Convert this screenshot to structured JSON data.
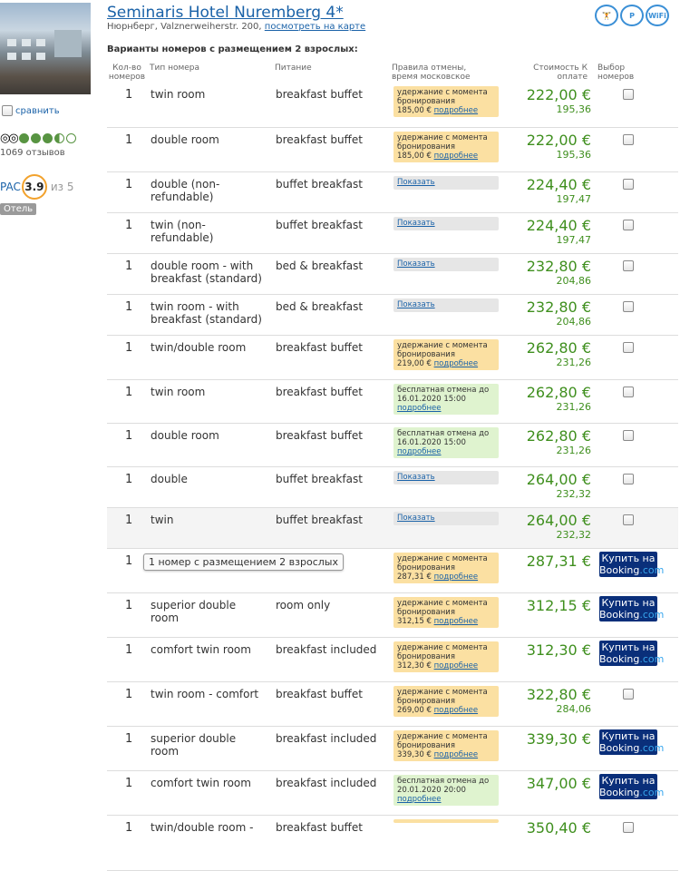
{
  "hotel": {
    "name": "Seminaris Hotel Nuremberg 4*",
    "address": "Нюрнберг, Valznerweiherstr. 200,",
    "map_link": "посмотреть на карте",
    "compare_label": "сравнить",
    "reviews": "1069 отзывов",
    "rating_prefix": "PAC",
    "rating": "3.9",
    "rating_of": "из 5",
    "tag": "Отель"
  },
  "amenities": [
    "fitness-icon",
    "parking-icon",
    "wifi-icon"
  ],
  "amenity_labels": [
    "🏋",
    "P",
    "WiFi"
  ],
  "section_title": "Варианты номеров с размещением 2 взрослых:",
  "columns": {
    "qty": "Кол-во номеров",
    "type": "Тип номера",
    "meal": "Питание",
    "cancel": "Правила отмены, время московское",
    "price": "Стоимость К оплате",
    "select": "Выбор номеров"
  },
  "rows": [
    {
      "qty": "1",
      "type": "twin room",
      "meal": "breakfast buffet",
      "cancel_kind": "orange",
      "cancel_text": "удержание с момента бронирования",
      "cancel_amount": "185,00 €",
      "cancel_link": "подробнее",
      "price": "222,00 €",
      "sub": "195,36",
      "action": "checkbox"
    },
    {
      "qty": "1",
      "type": "double room",
      "meal": "breakfast buffet",
      "cancel_kind": "orange",
      "cancel_text": "удержание с момента бронирования",
      "cancel_amount": "185,00 €",
      "cancel_link": "подробнее",
      "price": "222,00 €",
      "sub": "195,36",
      "action": "checkbox"
    },
    {
      "qty": "1",
      "type": "double (non-refundable)",
      "meal": "buffet breakfast",
      "cancel_kind": "gray",
      "cancel_text": "",
      "cancel_amount": "",
      "cancel_link": "Показать",
      "price": "224,40 €",
      "sub": "197,47",
      "action": "checkbox"
    },
    {
      "qty": "1",
      "type": "twin (non-refundable)",
      "meal": "buffet breakfast",
      "cancel_kind": "gray",
      "cancel_text": "",
      "cancel_amount": "",
      "cancel_link": "Показать",
      "price": "224,40 €",
      "sub": "197,47",
      "action": "checkbox"
    },
    {
      "qty": "1",
      "type": "double room - with breakfast (standard)",
      "meal": "bed & breakfast",
      "cancel_kind": "gray",
      "cancel_text": "",
      "cancel_amount": "",
      "cancel_link": "Показать",
      "price": "232,80 €",
      "sub": "204,86",
      "action": "checkbox"
    },
    {
      "qty": "1",
      "type": "twin room - with breakfast (standard)",
      "meal": "bed & breakfast",
      "cancel_kind": "gray",
      "cancel_text": "",
      "cancel_amount": "",
      "cancel_link": "Показать",
      "price": "232,80 €",
      "sub": "204,86",
      "action": "checkbox"
    },
    {
      "qty": "1",
      "type": "twin/double room",
      "meal": "breakfast buffet",
      "cancel_kind": "orange",
      "cancel_text": "удержание с момента бронирования",
      "cancel_amount": "219,00 €",
      "cancel_link": "подробнее",
      "price": "262,80 €",
      "sub": "231,26",
      "action": "checkbox"
    },
    {
      "qty": "1",
      "type": "twin room",
      "meal": "breakfast buffet",
      "cancel_kind": "green",
      "cancel_text": "бесплатная отмена до 16.01.2020 15:00",
      "cancel_amount": "",
      "cancel_link": "подробнее",
      "price": "262,80 €",
      "sub": "231,26",
      "action": "checkbox"
    },
    {
      "qty": "1",
      "type": "double room",
      "meal": "breakfast buffet",
      "cancel_kind": "green",
      "cancel_text": "бесплатная отмена до 16.01.2020 15:00",
      "cancel_amount": "",
      "cancel_link": "подробнее",
      "price": "262,80 €",
      "sub": "231,26",
      "action": "checkbox"
    },
    {
      "qty": "1",
      "type": "double",
      "meal": "buffet breakfast",
      "cancel_kind": "gray",
      "cancel_text": "",
      "cancel_amount": "",
      "cancel_link": "Показать",
      "price": "264,00 €",
      "sub": "232,32",
      "action": "checkbox"
    },
    {
      "qty": "1",
      "type": "twin",
      "meal": "buffet breakfast",
      "cancel_kind": "gray",
      "cancel_text": "",
      "cancel_amount": "",
      "cancel_link": "Показать",
      "price": "264,00 €",
      "sub": "232,32",
      "action": "checkbox"
    },
    {
      "qty": "1",
      "type": "",
      "meal": "",
      "tooltip": "1 номер с размещением 2 взрослых",
      "cancel_kind": "orange",
      "cancel_text": "удержание с момента бронирования",
      "cancel_amount": "287,31 €",
      "cancel_link": "подробнее",
      "price": "287,31 €",
      "sub": "",
      "action": "booking"
    },
    {
      "qty": "1",
      "type": "superior double room",
      "meal": "room only",
      "cancel_kind": "orange",
      "cancel_text": "удержание с момента бронирования",
      "cancel_amount": "312,15 €",
      "cancel_link": "подробнее",
      "price": "312,15 €",
      "sub": "",
      "action": "booking"
    },
    {
      "qty": "1",
      "type": "comfort twin room",
      "meal": "breakfast included",
      "cancel_kind": "orange",
      "cancel_text": "удержание с момента бронирования",
      "cancel_amount": "312,30 €",
      "cancel_link": "подробнее",
      "price": "312,30 €",
      "sub": "",
      "action": "booking"
    },
    {
      "qty": "1",
      "type": "twin room - comfort",
      "meal": "breakfast buffet",
      "cancel_kind": "orange",
      "cancel_text": "удержание с момента бронирования",
      "cancel_amount": "269,00 €",
      "cancel_link": "подробнее",
      "price": "322,80 €",
      "sub": "284,06",
      "action": "checkbox"
    },
    {
      "qty": "1",
      "type": "superior double room",
      "meal": "breakfast included",
      "cancel_kind": "orange",
      "cancel_text": "удержание с момента бронирования",
      "cancel_amount": "339,30 €",
      "cancel_link": "подробнее",
      "price": "339,30 €",
      "sub": "",
      "action": "booking"
    },
    {
      "qty": "1",
      "type": "comfort twin room",
      "meal": "breakfast included",
      "cancel_kind": "green",
      "cancel_text": "бесплатная отмена до 20.01.2020 20:00",
      "cancel_amount": "",
      "cancel_link": "подробнее",
      "price": "347,00 €",
      "sub": "",
      "action": "booking"
    },
    {
      "qty": "1",
      "type": "twin/double room -",
      "meal": "breakfast buffet",
      "cancel_kind": "orange",
      "cancel_text": "",
      "cancel_amount": "",
      "cancel_link": "",
      "price": "350,40 €",
      "sub": "",
      "action": "checkbox"
    }
  ],
  "booking_button": {
    "line1": "Купить на",
    "line2a": "Booking",
    "line2b": ".com"
  },
  "colors": {
    "price_green": "#3f8f1e",
    "link_blue": "#1a62a8",
    "orange_bg": "#fbe0a2",
    "green_bg": "#dff3cf",
    "booking_navy": "#0a2f7a"
  }
}
